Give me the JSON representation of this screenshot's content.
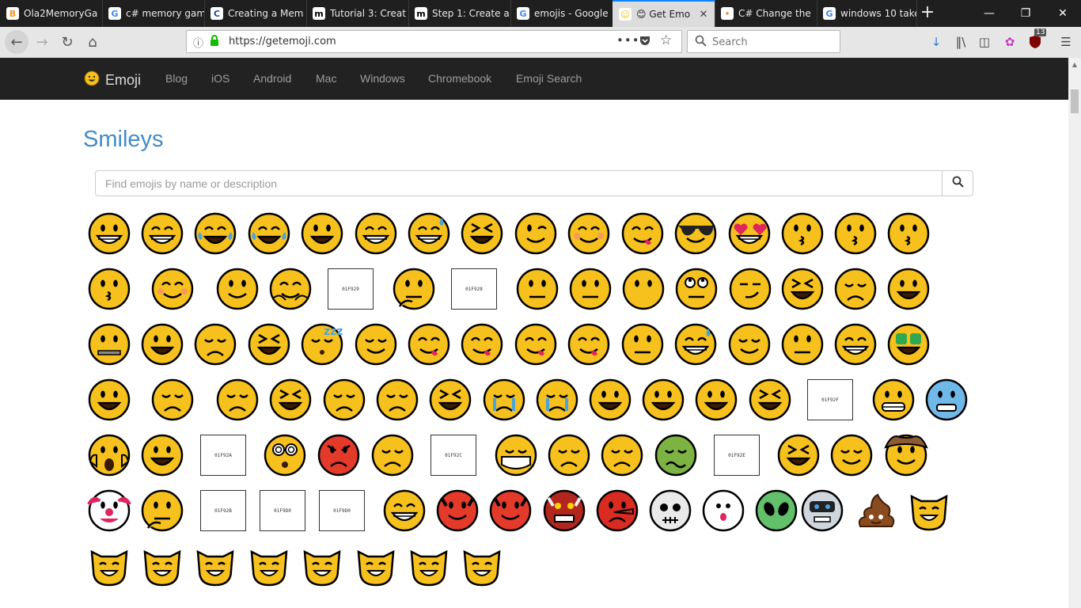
{
  "browser": {
    "tabs": [
      {
        "label": "Ola2MemoryGa",
        "icon_text": "B",
        "icon_color": "#f7931a"
      },
      {
        "label": "c# memory gam",
        "icon_text": "G",
        "icon_color": "#4285f4"
      },
      {
        "label": "Creating a Mem",
        "icon_text": "C",
        "icon_color": "#1a4aa8"
      },
      {
        "label": "Tutorial 3: Creat",
        "icon_text": "m",
        "icon_color": "#000000"
      },
      {
        "label": "Step 1: Create a",
        "icon_text": "m",
        "icon_color": "#000000"
      },
      {
        "label": "emojis - Google",
        "icon_text": "G",
        "icon_color": "#4285f4"
      },
      {
        "label": "😊 Get Emo",
        "icon_text": "☺",
        "icon_color": "#f6c000"
      },
      {
        "label": "C# Change the",
        "icon_text": "⬩",
        "icon_color": "#f48024"
      },
      {
        "label": "windows 10 take",
        "icon_text": "G",
        "icon_color": "#4285f4"
      }
    ],
    "url": "https://getemoji.com",
    "search_placeholder": "Search",
    "badge_count": "13",
    "accent_color": "#0a84ff"
  },
  "site": {
    "brand": "Emoji",
    "nav": [
      "Blog",
      "iOS",
      "Android",
      "Mac",
      "Windows",
      "Chromebook",
      "Emoji Search"
    ]
  },
  "page": {
    "heading": "Smileys",
    "search_placeholder": "Find emojis by name or description",
    "heading_color": "#428bca"
  },
  "missing_glyphs": {
    "g1": [
      "01F",
      "929"
    ],
    "g2": [
      "01F",
      "928"
    ],
    "g3": [
      "01F",
      "92F"
    ],
    "g4": [
      "01F",
      "92A"
    ],
    "g5": [
      "01F",
      "92C"
    ],
    "g6": [
      "01F",
      "92E"
    ],
    "g7": [
      "01F",
      "92B"
    ],
    "g8": [
      "01F",
      "9D0"
    ],
    "g9": [
      "01F",
      "9D0"
    ]
  },
  "emojis": [
    {
      "name": "grinning-face",
      "kind": "smile"
    },
    {
      "name": "beaming-face",
      "kind": "grin"
    },
    {
      "name": "tears-of-joy",
      "kind": "joy"
    },
    {
      "name": "rolling-laughing",
      "kind": "joy"
    },
    {
      "name": "grinning-big-eyes",
      "kind": "open"
    },
    {
      "name": "grinning-smiling-eyes",
      "kind": "grin"
    },
    {
      "name": "grinning-sweat",
      "kind": "sweat"
    },
    {
      "name": "squinting-face",
      "kind": "squint"
    },
    {
      "name": "winking-face",
      "kind": "wink"
    },
    {
      "name": "smiling-eyes",
      "kind": "blush"
    },
    {
      "name": "savoring-food",
      "kind": "tongue"
    },
    {
      "name": "sunglasses",
      "kind": "cool"
    },
    {
      "name": "heart-eyes",
      "kind": "heart"
    },
    {
      "name": "blowing-kiss",
      "kind": "kiss"
    },
    {
      "name": "kissing-face",
      "kind": "kiss"
    },
    {
      "name": "kissing-smiling-eyes",
      "kind": "kiss"
    },
    {
      "name": "kissing-closed-eyes",
      "kind": "kiss"
    },
    {
      "name": "smiling-face",
      "kind": "blush"
    },
    {
      "name": "slight-smile",
      "kind": "neutral"
    },
    {
      "name": "hugging-face",
      "kind": "hug"
    },
    {
      "name": "missing-1",
      "kind": "box",
      "glyph": "g1"
    },
    {
      "name": "thinking-face",
      "kind": "think"
    },
    {
      "name": "missing-2",
      "kind": "box",
      "glyph": "g2"
    },
    {
      "name": "neutral-face",
      "kind": "flat"
    },
    {
      "name": "expressionless",
      "kind": "flat"
    },
    {
      "name": "no-mouth",
      "kind": "nomouth"
    },
    {
      "name": "rolling-eyes",
      "kind": "roll"
    },
    {
      "name": "smirking-face",
      "kind": "smirk"
    },
    {
      "name": "persevering",
      "kind": "squint"
    },
    {
      "name": "sad-relieved",
      "kind": "sad"
    },
    {
      "name": "open-mouth",
      "kind": "open"
    },
    {
      "name": "zipper-mouth",
      "kind": "zip"
    },
    {
      "name": "hushed-face",
      "kind": "open"
    },
    {
      "name": "sleepy-face",
      "kind": "sad"
    },
    {
      "name": "tired-face",
      "kind": "squint"
    },
    {
      "name": "sleeping-face",
      "kind": "sleep"
    },
    {
      "name": "relieved-face",
      "kind": "calm"
    },
    {
      "name": "tongue-out",
      "kind": "tongue"
    },
    {
      "name": "winking-tongue",
      "kind": "tongue"
    },
    {
      "name": "squinting-tongue",
      "kind": "tongue"
    },
    {
      "name": "drooling-face",
      "kind": "tongue"
    },
    {
      "name": "unamused-face",
      "kind": "flat"
    },
    {
      "name": "downcast-sweat",
      "kind": "sweat"
    },
    {
      "name": "pensive-face",
      "kind": "calm"
    },
    {
      "name": "confused-face",
      "kind": "flat"
    },
    {
      "name": "upside-down",
      "kind": "grin"
    },
    {
      "name": "money-mouth",
      "kind": "money"
    },
    {
      "name": "astonished-face",
      "kind": "open"
    },
    {
      "name": "frowning-face",
      "kind": "sad"
    },
    {
      "name": "slight-frown",
      "kind": "sad"
    },
    {
      "name": "confounded-face",
      "kind": "squint"
    },
    {
      "name": "disappointed-face",
      "kind": "sad"
    },
    {
      "name": "worried-face",
      "kind": "sad"
    },
    {
      "name": "steam-nose",
      "kind": "squint"
    },
    {
      "name": "crying-face",
      "kind": "cry"
    },
    {
      "name": "loudly-crying",
      "kind": "cry"
    },
    {
      "name": "frowning-open",
      "kind": "open"
    },
    {
      "name": "anguished-face",
      "kind": "open"
    },
    {
      "name": "fearful-face",
      "kind": "open"
    },
    {
      "name": "weary-face",
      "kind": "squint"
    },
    {
      "name": "missing-3",
      "kind": "box",
      "glyph": "g3"
    },
    {
      "name": "grimacing-face",
      "kind": "grimace"
    },
    {
      "name": "anxious-sweat",
      "kind": "cold"
    },
    {
      "name": "screaming-fear",
      "kind": "scream"
    },
    {
      "name": "flushed-face",
      "kind": "open"
    },
    {
      "name": "missing-4",
      "kind": "box",
      "glyph": "g4"
    },
    {
      "name": "dizzy-face",
      "kind": "dizzy"
    },
    {
      "name": "pouting-face",
      "kind": "angry"
    },
    {
      "name": "angry-face",
      "kind": "sad"
    },
    {
      "name": "missing-5",
      "kind": "box",
      "glyph": "g5"
    },
    {
      "name": "medical-mask",
      "kind": "mask"
    },
    {
      "name": "thermometer-face",
      "kind": "sad"
    },
    {
      "name": "head-bandage",
      "kind": "sad"
    },
    {
      "name": "nauseated-face",
      "kind": "sick"
    },
    {
      "name": "missing-6",
      "kind": "box",
      "glyph": "g6"
    },
    {
      "name": "sneezing-face",
      "kind": "squint"
    },
    {
      "name": "halo-face",
      "kind": "calm"
    },
    {
      "name": "cowboy-face",
      "kind": "cowboy"
    },
    {
      "name": "clown-face",
      "kind": "clown"
    },
    {
      "name": "lying-face",
      "kind": "think"
    },
    {
      "name": "missing-7",
      "kind": "box",
      "glyph": "g7"
    },
    {
      "name": "missing-8",
      "kind": "box",
      "glyph": "g8"
    },
    {
      "name": "missing-9",
      "kind": "box",
      "glyph": "g9"
    },
    {
      "name": "nerd-face",
      "kind": "grin"
    },
    {
      "name": "smiling-horns",
      "kind": "devil"
    },
    {
      "name": "angry-horns",
      "kind": "devil"
    },
    {
      "name": "ogre",
      "kind": "ogre"
    },
    {
      "name": "goblin",
      "kind": "goblin"
    },
    {
      "name": "skull",
      "kind": "skull"
    },
    {
      "name": "ghost",
      "kind": "ghost"
    },
    {
      "name": "alien",
      "kind": "alien"
    },
    {
      "name": "robot-face",
      "kind": "robot"
    },
    {
      "name": "pile-of-poo",
      "kind": "poo"
    },
    {
      "name": "grinning-cat",
      "kind": "cat"
    },
    {
      "name": "grinning-cat-smiling-eyes",
      "kind": "cat"
    },
    {
      "name": "cat-tears-of-joy",
      "kind": "cat"
    },
    {
      "name": "heart-eyes-cat",
      "kind": "cat"
    },
    {
      "name": "wry-smile-cat",
      "kind": "cat"
    },
    {
      "name": "kissing-cat",
      "kind": "cat"
    },
    {
      "name": "weary-cat",
      "kind": "cat"
    },
    {
      "name": "crying-cat",
      "kind": "cat"
    },
    {
      "name": "pouting-cat",
      "kind": "cat"
    }
  ]
}
